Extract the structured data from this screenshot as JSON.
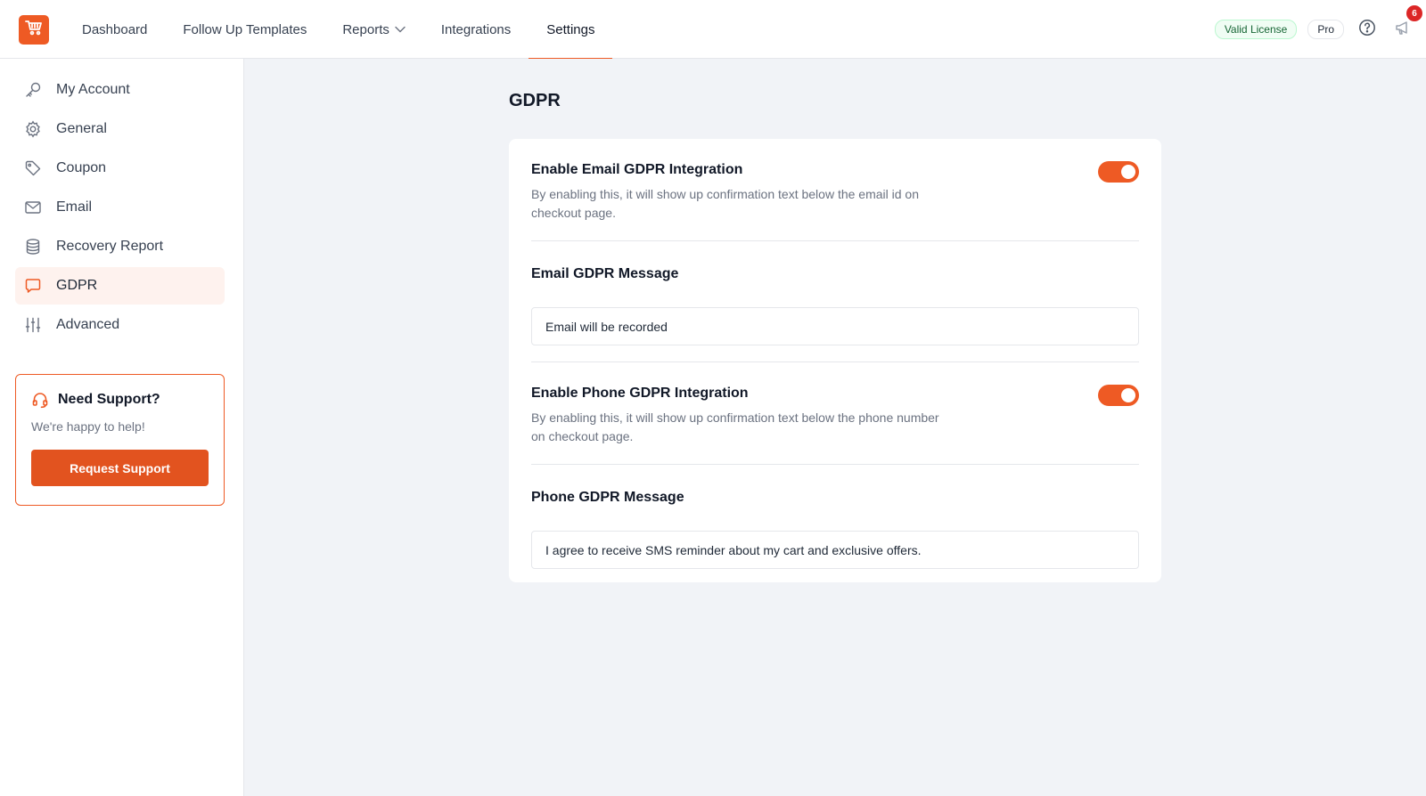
{
  "header": {
    "logo_icon": "cart-icon",
    "nav": [
      {
        "label": "Dashboard"
      },
      {
        "label": "Follow Up Templates"
      },
      {
        "label": "Reports"
      },
      {
        "label": "Integrations"
      },
      {
        "label": "Settings"
      }
    ],
    "active_nav": "Settings",
    "license_badge": "Valid License",
    "plan_badge": "Pro",
    "notification_count": "6"
  },
  "sidebar": {
    "items": [
      {
        "label": "My Account",
        "icon": "key-icon"
      },
      {
        "label": "General",
        "icon": "gear-icon"
      },
      {
        "label": "Coupon",
        "icon": "tag-icon"
      },
      {
        "label": "Email",
        "icon": "envelope-icon"
      },
      {
        "label": "Recovery Report",
        "icon": "database-icon"
      },
      {
        "label": "GDPR",
        "icon": "chat-bubble-icon"
      },
      {
        "label": "Advanced",
        "icon": "sliders-icon"
      }
    ],
    "active_item": "GDPR",
    "support": {
      "title": "Need Support?",
      "subtitle": "We're happy to help!",
      "button": "Request Support"
    }
  },
  "main": {
    "title": "GDPR",
    "email_toggle": {
      "title": "Enable Email GDPR Integration",
      "description": "By enabling this, it will show up confirmation text below the email id on checkout page.",
      "enabled": true
    },
    "email_message": {
      "title": "Email GDPR Message",
      "value": "Email will be recorded"
    },
    "phone_toggle": {
      "title": "Enable Phone GDPR Integration",
      "description": "By enabling this, it will show up confirmation text below the phone number on checkout page.",
      "enabled": true
    },
    "phone_message": {
      "title": "Phone GDPR Message",
      "value": "I agree to receive SMS reminder about my cart and exclusive offers."
    }
  },
  "colors": {
    "accent": "#ee5a24",
    "active_bg": "#fef2ee",
    "main_bg": "#f1f3f7",
    "license_green": "#166534"
  }
}
